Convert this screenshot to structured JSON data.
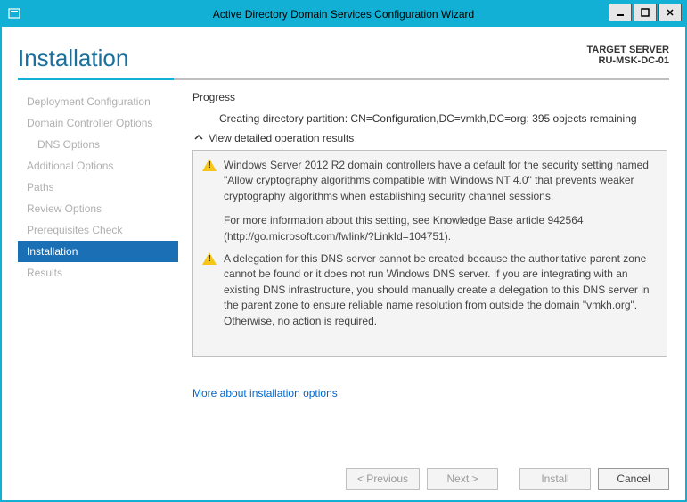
{
  "titlebar": {
    "title": "Active Directory Domain Services Configuration Wizard"
  },
  "header": {
    "page_title": "Installation",
    "target_label": "TARGET SERVER",
    "target_server": "RU-MSK-DC-01"
  },
  "nav": {
    "items": [
      {
        "label": "Deployment Configuration"
      },
      {
        "label": "Domain Controller Options"
      },
      {
        "label": "DNS Options",
        "sub": true
      },
      {
        "label": "Additional Options"
      },
      {
        "label": "Paths"
      },
      {
        "label": "Review Options"
      },
      {
        "label": "Prerequisites Check"
      },
      {
        "label": "Installation",
        "active": true
      },
      {
        "label": "Results"
      }
    ]
  },
  "content": {
    "progress_label": "Progress",
    "progress_status": "Creating directory partition: CN=Configuration,DC=vmkh,DC=org; 395 objects remaining",
    "collapse_label": "View detailed operation results",
    "warnings": [
      {
        "text1": "Windows Server 2012 R2 domain controllers have a default for the security setting named \"Allow cryptography algorithms compatible with Windows NT 4.0\" that prevents weaker cryptography algorithms when establishing security channel sessions.",
        "text2": "For more information about this setting, see Knowledge Base article 942564 (http://go.microsoft.com/fwlink/?LinkId=104751)."
      },
      {
        "text1": "A delegation for this DNS server cannot be created because the authoritative parent zone cannot be found or it does not run Windows DNS server. If you are integrating with an existing DNS infrastructure, you should manually create a delegation to this DNS server in the parent zone to ensure reliable name resolution from outside the domain \"vmkh.org\". Otherwise, no action is required."
      }
    ],
    "more_link": "More about installation options"
  },
  "footer": {
    "previous": "< Previous",
    "next": "Next >",
    "install": "Install",
    "cancel": "Cancel"
  }
}
